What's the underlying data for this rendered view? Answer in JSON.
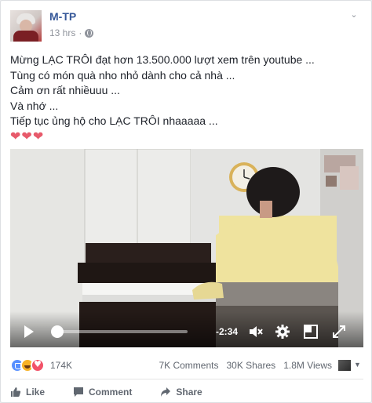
{
  "post": {
    "author": "M-TP",
    "time": "13 hrs",
    "text_lines": [
      "Mừng LẠC TRÔI đạt hơn 13.500.000 lượt xem trên youtube ...",
      "Tùng có món quà nho nhỏ dành cho cả nhà ...",
      "Cảm ơn rất nhiềuuu ...",
      "Và nhớ ...",
      "Tiếp tục ủng hộ cho LẠC TRÔI nhaaaaa ..."
    ],
    "hearts": "❤❤❤"
  },
  "video": {
    "time_remaining": "-2:34",
    "progress": 0.04,
    "icons": [
      "play-icon",
      "mute-icon",
      "settings-icon",
      "theater-mode-icon",
      "fullscreen-icon"
    ]
  },
  "stats": {
    "reaction_count": "174K",
    "comments": "7K Comments",
    "shares": "30K Shares",
    "views": "1.8M Views"
  },
  "actions": {
    "like": "Like",
    "comment": "Comment",
    "share": "Share"
  },
  "colors": {
    "author_link": "#365899",
    "secondary_text": "#616770",
    "heart": "#e75a6b"
  }
}
